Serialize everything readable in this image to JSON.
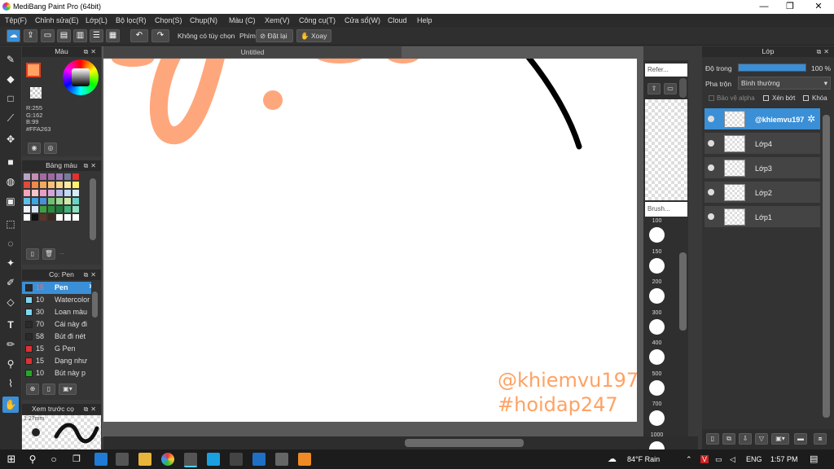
{
  "window": {
    "title": "MediBang Paint Pro (64bit)",
    "min": "—",
    "max": "❐",
    "close": "✕"
  },
  "menu": [
    "Tệp(F)",
    "Chỉnh sửa(E)",
    "Lớp(L)",
    "Bộ lọc(R)",
    "Chọn(S)",
    "Chụp(N)",
    "Màu (C)",
    "Xem(V)",
    "Công cụ(T)",
    "Cửa sổ(W)",
    "Cloud",
    "Help"
  ],
  "toolbar": {
    "undo": "↶",
    "redo": "↷",
    "no_options": "Không có tùy chọn",
    "key_label": "Phím",
    "reset_label": "Đặt lại",
    "rotate_label": "Xoay"
  },
  "color_panel": {
    "title": "Màu",
    "r": "R:255",
    "g": "G:162",
    "b": "B:99",
    "hex": "#FFA263",
    "fg_color": "#FFA263",
    "accent": "#3b8fd6"
  },
  "palette_panel": {
    "title": "Bảng màu",
    "more": "..."
  },
  "brush_panel": {
    "title": "Cọ: Pen",
    "items": [
      {
        "size": "15",
        "name": "Pen",
        "chip": "#2a2a2a"
      },
      {
        "size": "10",
        "name": "Watercolor",
        "chip": "#7fd6f0"
      },
      {
        "size": "30",
        "name": "Loan màu",
        "chip": "#7fd6f0"
      },
      {
        "size": "70",
        "name": "Cái này đi",
        "chip": "#2a2a2a"
      },
      {
        "size": "58",
        "name": "Bút đi nét",
        "chip": "#2a2a2a"
      },
      {
        "size": "15",
        "name": "G Pen",
        "chip": "#e23030"
      },
      {
        "size": "15",
        "name": "Dạng như",
        "chip": "#e23030"
      },
      {
        "size": "10",
        "name": "Bút này p",
        "chip": "#22aa22"
      }
    ]
  },
  "preview_panel": {
    "title": "Xem trước cọ",
    "size": "1.27mm"
  },
  "canvas": {
    "tab": "Untitled",
    "watermark_line1": "@khiemvu197",
    "watermark_line2": "#hoidap247"
  },
  "material_panel": {
    "title": "Refer...",
    "brush_title": "Brush..."
  },
  "brush_sizes": [
    "100",
    "150",
    "200",
    "300",
    "400",
    "500",
    "700",
    "1000"
  ],
  "layer_panel": {
    "title": "Lớp",
    "opacity_label": "Độ trong",
    "opacity_value": "100 %",
    "opacity": 1.0,
    "blend_label": "Pha trộn",
    "blend_value": "Bình thường",
    "protect_alpha": "Bảo vệ alpha",
    "clipping": "Xén bớt",
    "lock": "Khóa",
    "layers": [
      {
        "name": "@khiemvu197",
        "thumb": ""
      },
      {
        "name": "Lớp4",
        "thumb": ""
      },
      {
        "name": "Lớp3",
        "thumb": ""
      },
      {
        "name": "Lớp2",
        "thumb": ""
      },
      {
        "name": "Lớp1",
        "thumb": ""
      }
    ]
  },
  "taskbar": {
    "weather": "84°F  Rain",
    "lang": "ENG",
    "time": "1:57 PM"
  }
}
